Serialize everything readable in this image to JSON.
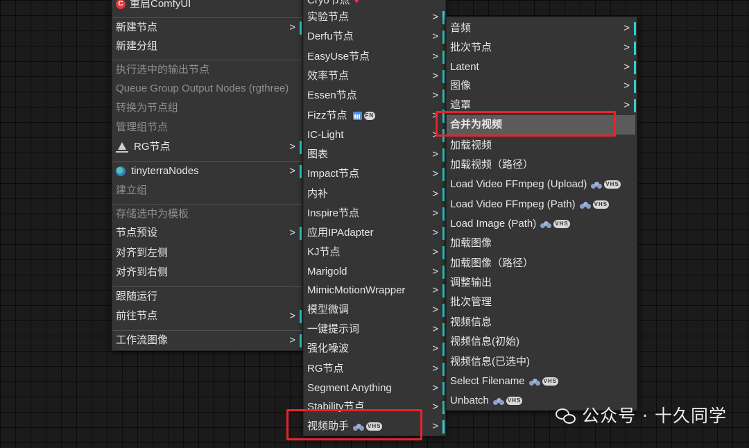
{
  "menu1": {
    "items": [
      {
        "label": "重启ComfyUI",
        "icon": "comfy-logo-icon"
      },
      {
        "label": "新建节点",
        "submenu": true
      },
      {
        "label": "新建分组"
      },
      {
        "label": "执行选中的输出节点",
        "disabled": true
      },
      {
        "label": "Queue Group Output Nodes (rgthree)",
        "disabled": true
      },
      {
        "label": "转换为节点组",
        "disabled": true
      },
      {
        "label": "管理组节点",
        "disabled": true
      },
      {
        "label": "RG节点",
        "icon": "rg-icon",
        "submenu": true
      },
      {
        "label": "tinyterraNodes",
        "icon": "globe-icon",
        "submenu": true
      },
      {
        "label": "建立组",
        "disabled": true
      },
      {
        "label": "存储选中为模板",
        "disabled": true
      },
      {
        "label": "节点预设",
        "submenu": true
      },
      {
        "label": "对齐到左侧"
      },
      {
        "label": "对齐到右侧"
      },
      {
        "label": "跟随运行"
      },
      {
        "label": "前往节点",
        "submenu": true
      },
      {
        "label": "工作流图像",
        "submenu": true
      }
    ],
    "arrow": ">",
    "logo_letter": "C"
  },
  "menu2": {
    "items": [
      {
        "label": "Cryo节点"
      },
      {
        "label": "实验节点"
      },
      {
        "label": "Derfu节点"
      },
      {
        "label": "EasyUse节点"
      },
      {
        "label": "效率节点"
      },
      {
        "label": "Essen节点"
      },
      {
        "label": "Fizz节点"
      },
      {
        "label": "IC-Light"
      },
      {
        "label": "图表"
      },
      {
        "label": "Impact节点"
      },
      {
        "label": "内补"
      },
      {
        "label": "Inspire节点"
      },
      {
        "label": "应用IPAdapter"
      },
      {
        "label": "KJ节点"
      },
      {
        "label": "Marigold"
      },
      {
        "label": "MimicMotionWrapper"
      },
      {
        "label": "模型微调"
      },
      {
        "label": "一键提示词"
      },
      {
        "label": "强化噪波"
      },
      {
        "label": "RG节点"
      },
      {
        "label": "Segment Anything"
      },
      {
        "label": "Stability节点"
      },
      {
        "label": "视频助手"
      }
    ],
    "fizz_badge": "FN",
    "vhs_badge": "VHS",
    "arrow": ">"
  },
  "menu3": {
    "items": [
      {
        "label": "音频",
        "submenu": true
      },
      {
        "label": "批次节点",
        "submenu": true
      },
      {
        "label": "Latent",
        "submenu": true
      },
      {
        "label": "图像",
        "submenu": true
      },
      {
        "label": "遮罩",
        "submenu": true
      },
      {
        "label": "合并为视频",
        "highlighted": true
      },
      {
        "label": "加载视频"
      },
      {
        "label": "加载视频（路径）"
      },
      {
        "label": "Load Video FFmpeg (Upload)",
        "vhs": true
      },
      {
        "label": "Load Video FFmpeg (Path)",
        "vhs": true
      },
      {
        "label": "Load Image (Path)",
        "vhs": true
      },
      {
        "label": "加载图像"
      },
      {
        "label": "加载图像（路径）"
      },
      {
        "label": "调整输出"
      },
      {
        "label": "批次管理"
      },
      {
        "label": "视频信息"
      },
      {
        "label": "视频信息(初始)"
      },
      {
        "label": "视频信息(已选中)"
      },
      {
        "label": "Select Filename",
        "vhs": true
      },
      {
        "label": "Unbatch",
        "vhs": true
      }
    ],
    "vhs_badge": "VHS",
    "arrow": ">"
  },
  "watermark": {
    "text": "公众号 · 十久同学"
  },
  "colors": {
    "highlight_border": "#e8242a",
    "submenu_marker": "#2fd0d0",
    "menu_bg": "#353535"
  }
}
